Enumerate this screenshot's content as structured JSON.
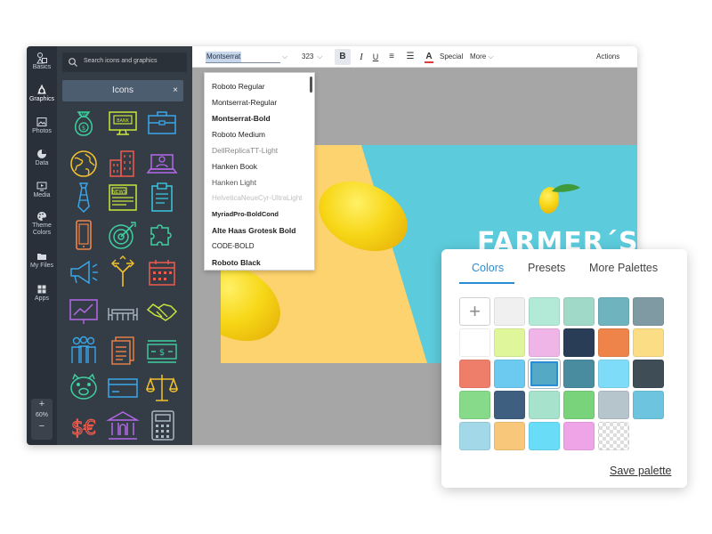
{
  "rail": {
    "items": [
      {
        "label": "Basics",
        "icon": "shapes-icon"
      },
      {
        "label": "Graphics",
        "icon": "graphics-icon"
      },
      {
        "label": "Photos",
        "icon": "image-icon"
      },
      {
        "label": "Data",
        "icon": "pie-chart-icon"
      },
      {
        "label": "Media",
        "icon": "media-icon"
      },
      {
        "label": "Theme Colors",
        "label_line1": "Theme",
        "label_line2": "Colors",
        "icon": "palette-icon"
      },
      {
        "label": "My Files",
        "icon": "folder-icon"
      },
      {
        "label": "Apps",
        "icon": "apps-grid-icon"
      }
    ],
    "zoom": {
      "plus": "+",
      "level": "60%",
      "minus": "−"
    }
  },
  "panel": {
    "search_placeholder": "Search icons and graphics",
    "section_title": "Icons",
    "close_symbol": "×",
    "icon_names": [
      "bank-bag-icon",
      "bank-monitor-icon",
      "briefcase-icon",
      "globe-icon",
      "buildings-icon",
      "laptop-user-icon",
      "tie-icon",
      "newspaper-icon",
      "clipboard-icon",
      "smartphone-icon",
      "target-icon",
      "puzzle-icon",
      "megaphone-icon",
      "direction-arrows-icon",
      "calendar-icon",
      "presentation-chart-icon",
      "meeting-table-icon",
      "handshake-icon",
      "team-icon",
      "documents-icon",
      "cash-icon",
      "piggy-bank-icon",
      "credit-card-icon",
      "scales-icon",
      "currency-icon",
      "bank-building-icon",
      "calculator-icon"
    ],
    "icon_texts": {
      "bank": "BANK",
      "news": "NEWS",
      "cash": "$",
      "currency": "$€"
    }
  },
  "toolbar": {
    "font": "Montserrat",
    "size": "323",
    "caret": "⌵",
    "bold": "B",
    "italic": "I",
    "underline": "U",
    "align": "≡",
    "list": "☰",
    "color": "A",
    "special": "Special",
    "more": "More",
    "actions": "Actions"
  },
  "font_dropdown": {
    "items": [
      "Roboto Regular",
      "Montserrat-Regular",
      "Montserrat-Bold",
      "Roboto Medium",
      "DellReplicaTT-Light",
      "Hanken Book",
      "Hanken Light",
      "HelveticaNeueCyr-UltraLight",
      "MyriadPro-BoldCond",
      "Alte Haas Grotesk Bold",
      "CODE-BOLD",
      "Roboto Black"
    ]
  },
  "canvas": {
    "brand_text": "FARMER´S",
    "colors": {
      "yellow": "#fdd36f",
      "cyan": "#5cccdd",
      "gray": "#a6a6a6"
    }
  },
  "palette": {
    "tabs": [
      "Colors",
      "Presets",
      "More Palettes"
    ],
    "active_tab": "Colors",
    "add_symbol": "+",
    "swatches": [
      [
        "#f0f0f0",
        "#b3ead7",
        "#a1d9c8",
        "#6fb3bf",
        "#7f9aa2"
      ],
      [
        "#ffffff",
        "#dff79a",
        "#efb5e6",
        "#2a3d56",
        "#ee844a",
        "#fbdd85"
      ],
      [
        "#ee7e6a",
        "#6ccaf1",
        "#54aac4",
        "#4a8c9f",
        "#7fdcf8",
        "#3f4d56"
      ],
      [
        "#86da8a",
        "#3e5f80",
        "#a7e2cc",
        "#79d37b",
        "#b6c4cb",
        "#6cc4df"
      ],
      [
        "#a3d8e8",
        "#f8c779",
        "#69ddf7",
        "#f0a4e8",
        "transparent"
      ]
    ],
    "selected": {
      "row": 2,
      "col": 2
    },
    "save_label": "Save palette"
  }
}
